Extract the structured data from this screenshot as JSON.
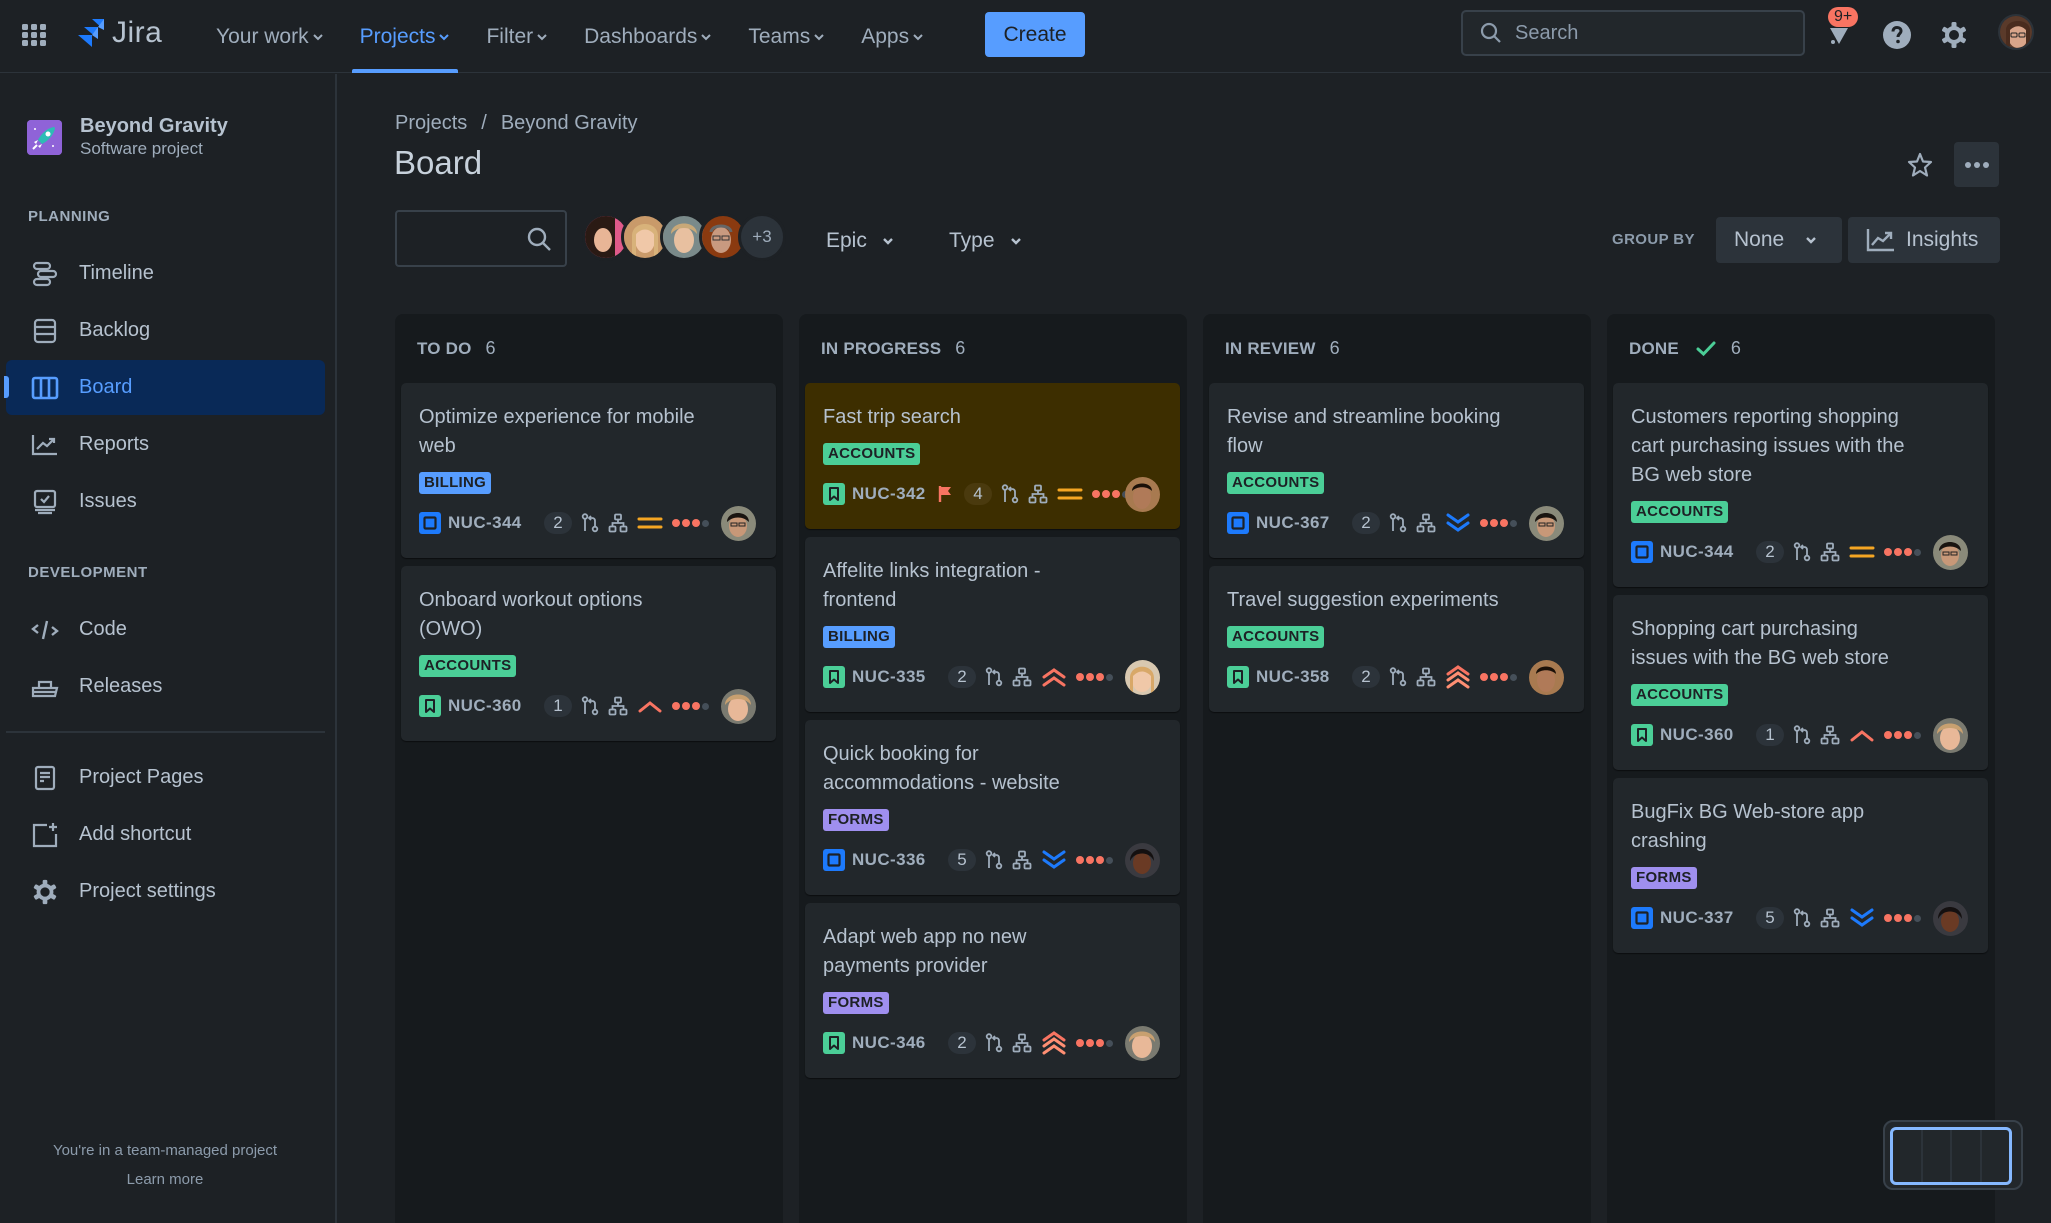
{
  "topnav": {
    "app_name": "Jira",
    "items": [
      {
        "label": "Your work",
        "active": false
      },
      {
        "label": "Projects",
        "active": true
      },
      {
        "label": "Filter",
        "active": false
      },
      {
        "label": "Dashboards",
        "active": false
      },
      {
        "label": "Teams",
        "active": false
      },
      {
        "label": "Apps",
        "active": false
      }
    ],
    "create_label": "Create",
    "search_placeholder": "Search",
    "notification_count": "9+",
    "icons": [
      "app-switcher-icon",
      "jira-logo-icon",
      "bell-icon",
      "help-icon",
      "settings-icon",
      "user-avatar"
    ]
  },
  "sidebar": {
    "project_name": "Beyond Gravity",
    "project_type": "Software project",
    "sections": [
      {
        "label": "PLANNING",
        "items": [
          {
            "label": "Timeline",
            "icon": "timeline-icon",
            "active": false
          },
          {
            "label": "Backlog",
            "icon": "backlog-icon",
            "active": false
          },
          {
            "label": "Board",
            "icon": "board-icon",
            "active": true
          },
          {
            "label": "Reports",
            "icon": "reports-icon",
            "active": false
          },
          {
            "label": "Issues",
            "icon": "issues-icon",
            "active": false
          }
        ]
      },
      {
        "label": "DEVELOPMENT",
        "items": [
          {
            "label": "Code",
            "icon": "code-icon",
            "active": false
          },
          {
            "label": "Releases",
            "icon": "releases-icon",
            "active": false
          }
        ]
      }
    ],
    "extra_items": [
      {
        "label": "Project Pages",
        "icon": "pages-icon"
      },
      {
        "label": "Add shortcut",
        "icon": "add-shortcut-icon"
      },
      {
        "label": "Project settings",
        "icon": "settings-icon"
      }
    ],
    "footer_text": "You're in a team-managed project",
    "footer_link": "Learn more"
  },
  "main": {
    "breadcrumb": [
      "Projects",
      "Beyond Gravity"
    ],
    "breadcrumb_sep": "/",
    "title": "Board",
    "search_value": "",
    "avatars_more": "+3",
    "filters": [
      {
        "label": "Epic"
      },
      {
        "label": "Type"
      }
    ],
    "group_by_label": "GROUP BY",
    "group_by_value": "None",
    "insights_label": "Insights"
  },
  "colors": {
    "accent": "#579dff",
    "tag_billing": "#579dff",
    "tag_accounts": "#4bce97",
    "tag_forms": "#9f8fef",
    "story": "#4bce97",
    "task": "#1d7afc",
    "flag": "#f87462",
    "prio_medium": "#f5a623",
    "prio_high": "#f87462",
    "prio_low": "#1d7afc"
  },
  "board": {
    "columns": [
      {
        "name": "TO DO",
        "count": "6",
        "done": false,
        "cards": [
          {
            "title": "Optimize experience for mobile web",
            "tag": "BILLING",
            "type": "task",
            "key": "NUC-344",
            "flagged": false,
            "count": "2",
            "priority": "medium",
            "assignee": "a1"
          },
          {
            "title": "Onboard workout options (OWO)",
            "tag": "ACCOUNTS",
            "type": "story",
            "key": "NUC-360",
            "flagged": false,
            "count": "1",
            "priority": "high",
            "assignee": "a2"
          }
        ]
      },
      {
        "name": "IN PROGRESS",
        "count": "6",
        "done": false,
        "cards": [
          {
            "title": "Fast trip search",
            "tag": "ACCOUNTS",
            "type": "story",
            "key": "NUC-342",
            "flagged": true,
            "count": "4",
            "priority": "medium",
            "assignee": "a3"
          },
          {
            "title": "Affelite links integration - frontend",
            "tag": "BILLING",
            "type": "story",
            "key": "NUC-335",
            "flagged": false,
            "count": "2",
            "priority": "highest",
            "assignee": "a4"
          },
          {
            "title": "Quick booking for accommodations - website",
            "tag": "FORMS",
            "type": "task",
            "key": "NUC-336",
            "flagged": false,
            "count": "5",
            "priority": "lowest",
            "assignee": "a5"
          },
          {
            "title": "Adapt web app no new payments provider",
            "tag": "FORMS",
            "type": "story",
            "key": "NUC-346",
            "flagged": false,
            "count": "2",
            "priority": "critical",
            "assignee": "a2"
          }
        ]
      },
      {
        "name": "IN REVIEW",
        "count": "6",
        "done": false,
        "cards": [
          {
            "title": "Revise and streamline booking flow",
            "tag": "ACCOUNTS",
            "type": "task",
            "key": "NUC-367",
            "flagged": false,
            "count": "2",
            "priority": "lowest",
            "assignee": "a1"
          },
          {
            "title": "Travel suggestion experiments",
            "tag": "ACCOUNTS",
            "type": "story",
            "key": "NUC-358",
            "flagged": false,
            "count": "2",
            "priority": "critical",
            "assignee": "a3"
          }
        ]
      },
      {
        "name": "DONE",
        "count": "6",
        "done": true,
        "cards": [
          {
            "title": "Customers reporting shopping cart purchasing issues with the BG web store",
            "tag": "ACCOUNTS",
            "type": "task",
            "key": "NUC-344",
            "flagged": false,
            "count": "2",
            "priority": "medium",
            "assignee": "a1"
          },
          {
            "title": "Shopping cart purchasing issues with the BG web store",
            "tag": "ACCOUNTS",
            "type": "story",
            "key": "NUC-360",
            "flagged": false,
            "count": "1",
            "priority": "high",
            "assignee": "a2"
          },
          {
            "title": "BugFix BG Web-store app crashing",
            "tag": "FORMS",
            "type": "task",
            "key": "NUC-337",
            "flagged": false,
            "count": "5",
            "priority": "lowest",
            "assignee": "a5"
          }
        ]
      }
    ]
  }
}
